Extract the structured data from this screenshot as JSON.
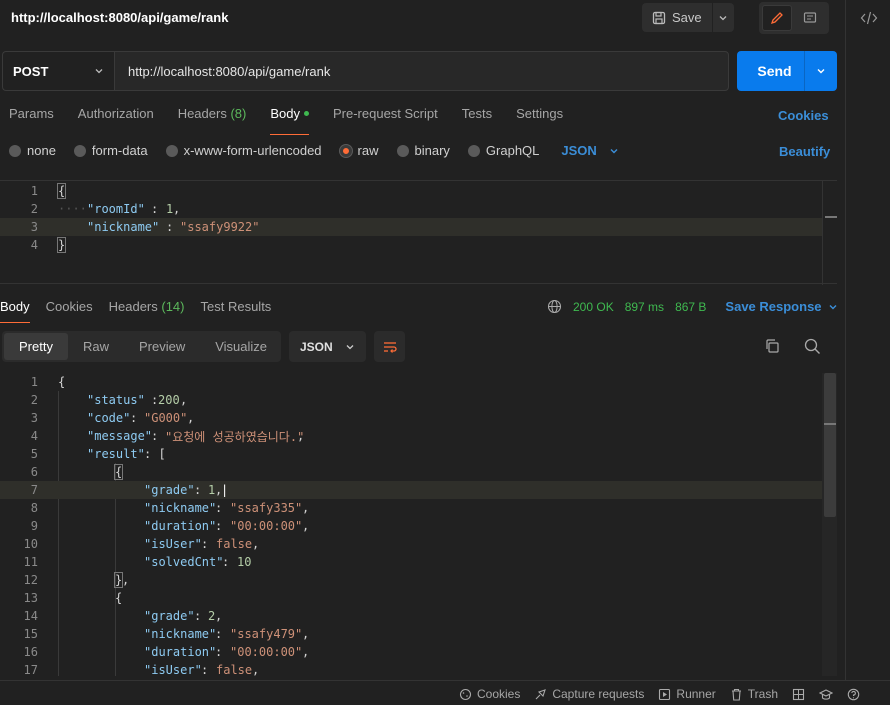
{
  "header": {
    "title": "http://localhost:8080/api/game/rank",
    "save_label": "Save"
  },
  "request": {
    "method": "POST",
    "url": "http://localhost:8080/api/game/rank",
    "send_label": "Send",
    "tabs": [
      {
        "label": "Params"
      },
      {
        "label": "Authorization"
      },
      {
        "label": "Headers",
        "count": "(8)"
      },
      {
        "label": "Body",
        "active": true
      },
      {
        "label": "Pre-request Script"
      },
      {
        "label": "Tests"
      },
      {
        "label": "Settings"
      }
    ],
    "cookies_label": "Cookies",
    "body_types": [
      "none",
      "form-data",
      "x-www-form-urlencoded",
      "raw",
      "binary",
      "GraphQL"
    ],
    "body_type_selected": "raw",
    "body_format": "JSON",
    "beautify_label": "Beautify",
    "body_lines": {
      "n1": "1",
      "n2": "2",
      "n3": "3",
      "n4": "4",
      "open": "{",
      "k1": "\"roomId\"",
      "v1": "1",
      "k2": "\"nickname\"",
      "v2": "\"ssafy9922\"",
      "close": "}"
    }
  },
  "response": {
    "tabs": [
      {
        "label": "Body",
        "active": true
      },
      {
        "label": "Cookies"
      },
      {
        "label": "Headers",
        "count": "(14)"
      },
      {
        "label": "Test Results"
      }
    ],
    "status": "200 OK",
    "time": "897 ms",
    "size": "867 B",
    "save_response_label": "Save Response",
    "view_tabs": [
      "Pretty",
      "Raw",
      "Preview",
      "Visualize"
    ],
    "format": "JSON",
    "lines": {
      "l1": "1",
      "l2": "2",
      "l3": "3",
      "l4": "4",
      "l5": "5",
      "l6": "6",
      "l7": "7",
      "l8": "8",
      "l9": "9",
      "l10": "10",
      "l11": "11",
      "l12": "12",
      "l13": "13",
      "l14": "14",
      "l15": "15",
      "l16": "16",
      "l17": "17",
      "k_status": "\"status\"",
      "v_status": "200",
      "k_code": "\"code\"",
      "v_code": "\"G000\"",
      "k_message": "\"message\"",
      "v_message": "\"요청에 성공하였습니다.\"",
      "k_result": "\"result\"",
      "k_grade": "\"grade\"",
      "v_grade1": "1",
      "v_grade2": "2",
      "k_nickname": "\"nickname\"",
      "v_nick1": "\"ssafy335\"",
      "v_nick2": "\"ssafy479\"",
      "k_duration": "\"duration\"",
      "v_duration": "\"00:00:00\"",
      "k_isUser": "\"isUser\"",
      "v_isUser": "false",
      "k_solved": "\"solvedCnt\"",
      "v_solved": "10"
    }
  },
  "footer": {
    "items": [
      "Cookies",
      "Capture requests",
      "Runner",
      "Trash"
    ]
  },
  "colors": {
    "accent": "#097bed",
    "active_tab_underline": "#ff6c37",
    "success": "#3fb950",
    "link": "#3b8ed8"
  }
}
